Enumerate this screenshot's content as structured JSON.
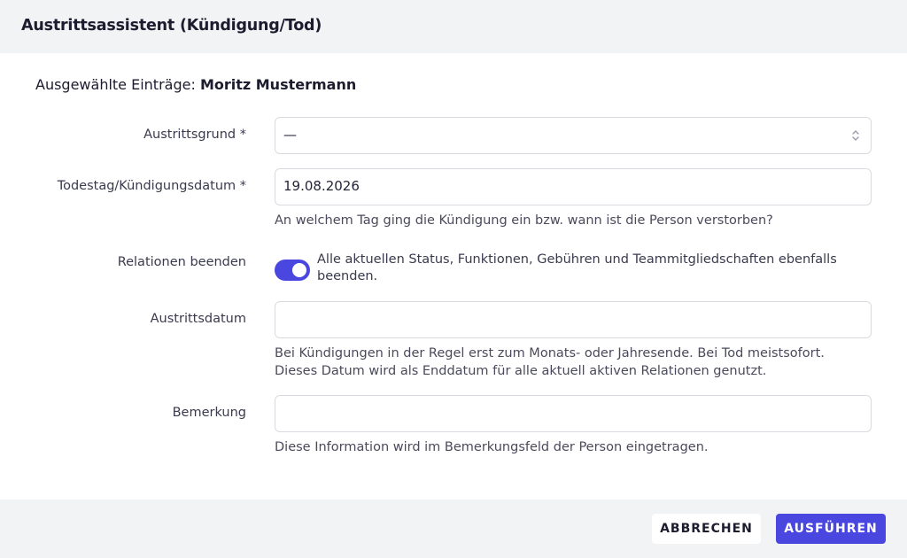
{
  "dialog": {
    "title": "Austrittsassistent (Kündigung/Tod)"
  },
  "selection": {
    "prefix": "Ausgewählte Einträge:",
    "name": "Moritz Mustermann"
  },
  "form": {
    "reason": {
      "label": "Austrittsgrund *",
      "value": "—"
    },
    "date": {
      "label": "Todestag/Kündigungsdatum *",
      "value": "19.08.2026",
      "help": "An welchem Tag ging die Kündigung ein bzw. wann ist die Person verstorben?"
    },
    "relations": {
      "label": "Relationen beenden",
      "enabled": true,
      "text": "Alle aktuellen Status, Funktionen, Gebühren und Teammitgliedschaften ebenfalls beenden."
    },
    "exit_date": {
      "label": "Austrittsdatum",
      "value": "",
      "help_line1": "Bei Kündigungen in der Regel erst zum Monats- oder Jahresende. Bei Tod meistsofort.",
      "help_line2": "Dieses Datum wird als Enddatum für alle aktuell aktiven Relationen genutzt."
    },
    "remark": {
      "label": "Bemerkung",
      "value": "",
      "help": "Diese Information wird im Bemerkungsfeld der Person eingetragen."
    }
  },
  "footer": {
    "cancel_label": "ABBRECHEN",
    "run_label": "AUSFÜHREN"
  },
  "colors": {
    "accent": "#4a47e0",
    "header_bg": "#f2f3f5",
    "border": "#d9dbe0"
  },
  "icons": {
    "select": "chevron-up-down-icon",
    "toggle": "toggle-switch"
  }
}
